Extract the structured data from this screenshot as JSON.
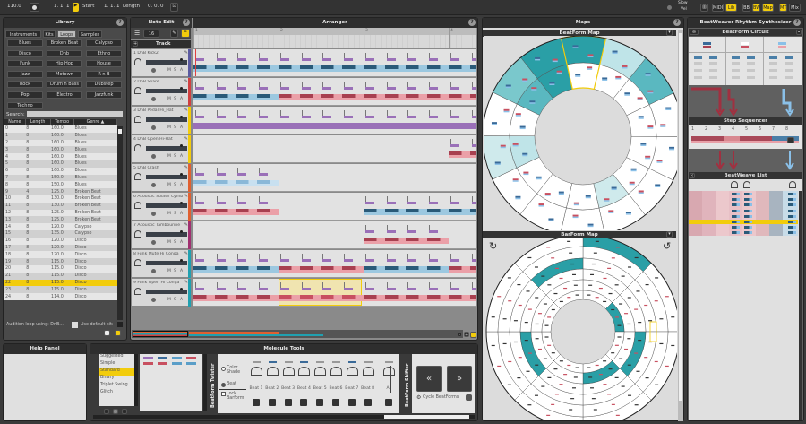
{
  "topbar": {
    "tempo": "110.0",
    "start_pos": "1. 1. 1",
    "start_label": "Start",
    "length_pos": "1. 1. 1",
    "length_label": "Length",
    "offset": "0. 0. 0",
    "slow_label": "Slow",
    "vel_label": "Vel",
    "buttons": [
      {
        "label": "MIDI",
        "active": false
      },
      {
        "label": "Lib",
        "active": true
      },
      {
        "label": "BB",
        "active": false
      },
      {
        "label": "BW",
        "active": true
      },
      {
        "label": "Map",
        "active": true
      },
      {
        "label": "MT",
        "active": true
      },
      {
        "label": "Mix",
        "active": false
      }
    ]
  },
  "library": {
    "title": "Library",
    "tabs": [
      "Instruments",
      "Kits",
      "Loops",
      "Samples"
    ],
    "active_tab": "Loops",
    "genres": [
      "Blues",
      "Broken Beat",
      "Calypso",
      "Disco",
      "Dnb",
      "Ethno",
      "Funk",
      "Hip Hop",
      "House",
      "Jazz",
      "Motown",
      "R n B",
      "Rock",
      "Drum n Bass",
      "Dubstep",
      "Pop",
      "Electro",
      "Jazzfunk",
      "Techno"
    ],
    "search_label": "Search:",
    "search_value": "",
    "columns": [
      "Name",
      "Length",
      "Tempo",
      "Genre ▲"
    ],
    "rows": [
      [
        "0",
        "8",
        "160.0",
        "Blues"
      ],
      [
        "1",
        "8",
        "160.0",
        "Blues"
      ],
      [
        "2",
        "8",
        "160.0",
        "Blues"
      ],
      [
        "3",
        "8",
        "160.0",
        "Blues"
      ],
      [
        "4",
        "8",
        "160.0",
        "Blues"
      ],
      [
        "5",
        "8",
        "160.0",
        "Blues"
      ],
      [
        "6",
        "8",
        "160.0",
        "Blues"
      ],
      [
        "7",
        "8",
        "150.0",
        "Blues"
      ],
      [
        "8",
        "8",
        "150.0",
        "Blues"
      ],
      [
        "9",
        "4",
        "125.0",
        "Broken Beat"
      ],
      [
        "10",
        "8",
        "130.0",
        "Broken Beat"
      ],
      [
        "11",
        "8",
        "130.0",
        "Broken Beat"
      ],
      [
        "12",
        "8",
        "125.0",
        "Broken Beat"
      ],
      [
        "13",
        "8",
        "125.0",
        "Broken Beat"
      ],
      [
        "14",
        "8",
        "120.0",
        "Calypso"
      ],
      [
        "15",
        "8",
        "135.0",
        "Calypso"
      ],
      [
        "16",
        "8",
        "120.0",
        "Disco"
      ],
      [
        "17",
        "8",
        "120.0",
        "Disco"
      ],
      [
        "18",
        "8",
        "120.0",
        "Disco"
      ],
      [
        "19",
        "8",
        "115.0",
        "Disco"
      ],
      [
        "20",
        "8",
        "115.0",
        "Disco"
      ],
      [
        "21",
        "8",
        "115.0",
        "Disco"
      ],
      [
        "22",
        "8",
        "115.0",
        "Disco"
      ],
      [
        "23",
        "8",
        "115.0",
        "Disco"
      ],
      [
        "24",
        "8",
        "114.0",
        "Disco"
      ]
    ],
    "selected_row": 22,
    "audition_label": "Audition loop using: DnB...",
    "default_kit_label": "Use default kit:"
  },
  "note_edit": {
    "title": "Note Edit",
    "grid_value": "16",
    "track_header": "Track",
    "tracks": [
      {
        "name": "1 DnB Kick2",
        "color": "#5a5aa0"
      },
      {
        "name": "2 DnB Snare",
        "color": "#d04040"
      },
      {
        "name": "3 DnB Pedal Hi_Hat",
        "color": "#f2cc0c"
      },
      {
        "name": "4 DnB Open Hi-Hat",
        "color": "#f2cc0c"
      },
      {
        "name": "5 DnB Crash",
        "color": "#e06030"
      },
      {
        "name": "6 Acoustic Splash Cymb",
        "color": "#e06030"
      },
      {
        "name": "7 Acoustic Tambourine",
        "color": "#a03070"
      },
      {
        "name": "8 Funk Mute Hi Conga",
        "color": "#20a0b0"
      },
      {
        "name": "9 Funk Open Hi Conga",
        "color": "#20a0b0"
      }
    ],
    "track_buttons": [
      "M",
      "S",
      "A"
    ]
  },
  "arranger": {
    "title": "Arranger",
    "bars": [
      "1",
      "2",
      "3",
      "4"
    ]
  },
  "maps": {
    "title": "Maps",
    "beatform_title": "BeatForm Map",
    "barform_title": "BarForm Map"
  },
  "help_panel": {
    "title": "Help Panel"
  },
  "molecule_tools": {
    "title": "Molecule Tools",
    "presets": [
      "Suggested",
      "Simple",
      "Standard",
      "Binary",
      "Triplet Swing",
      "Glitch"
    ],
    "selected_preset": "Standard",
    "twister_label": "BeatForm Twister",
    "shifter_label": "BeatForm Shifter",
    "modes": [
      {
        "label": "Color Shade",
        "checked": false
      },
      {
        "label": "Beat",
        "checked": true
      }
    ],
    "lock_label": "Lock Barform",
    "knobs": [
      "Beat 1",
      "Beat 2",
      "Beat 3",
      "Beat 4",
      "Beat 5",
      "Beat 6",
      "Beat 7",
      "Beat 8",
      "All"
    ],
    "prev_label": "«",
    "next_label": "»",
    "cycle_label": "Cycle BeatForms"
  },
  "synth": {
    "title": "BeatWeaver Rhythm Synthesizer",
    "circuit_title": "BeatForm Circuit",
    "step_title": "Step Sequencer",
    "steps": [
      "1",
      "2",
      "3",
      "4",
      "5",
      "6",
      "7",
      "8"
    ],
    "list_title": "BeatWeave List"
  },
  "colors": {
    "accent": "#f2cc0c",
    "teal": "#2a9fa6",
    "red": "#c85060",
    "blue": "#5a9ec8",
    "purple": "#9a70b8"
  }
}
